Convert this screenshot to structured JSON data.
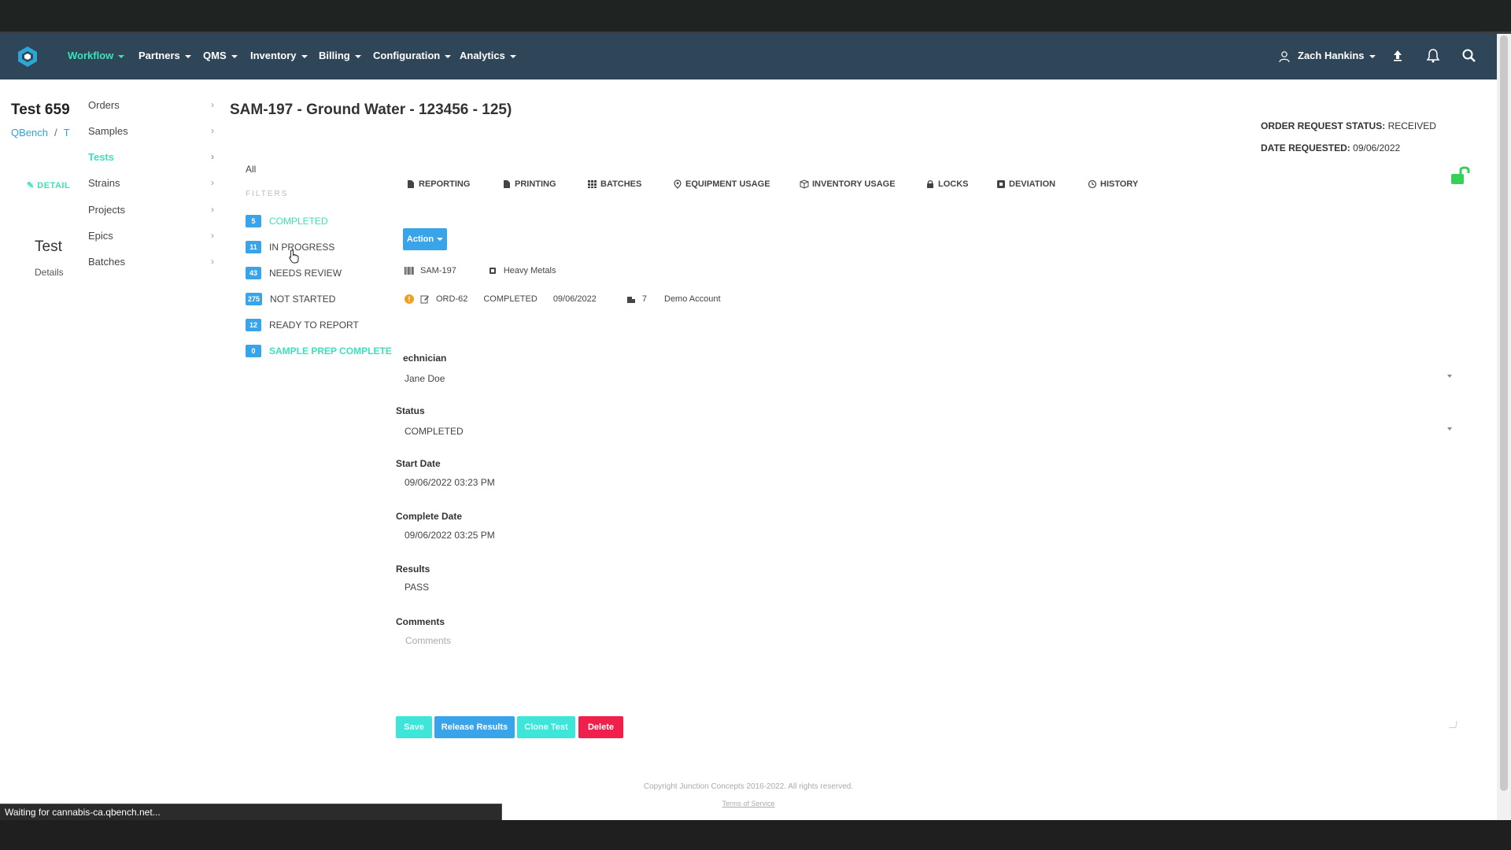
{
  "nav": {
    "items": [
      "Workflow",
      "Partners",
      "QMS",
      "Inventory",
      "Billing",
      "Configuration",
      "Analytics"
    ],
    "user": "Zach Hankins",
    "accent": "#3ee0bd",
    "bar_color": "#2e4658"
  },
  "left": {
    "test_title": "Test 659",
    "crumb_home": "QBench",
    "crumb_sep": "/",
    "crumb_current": "T",
    "detail_link": "DETAIL",
    "test_big": "Test",
    "test_sub": "Details"
  },
  "subnav": [
    "Orders",
    "Samples",
    "Tests",
    "Strains",
    "Projects",
    "Epics",
    "Batches"
  ],
  "header": {
    "sample_title": "SAM-197 - Ground Water - 123456 - 125)",
    "order_status_label": "ORDER REQUEST STATUS:",
    "order_status_value": "RECEIVED",
    "date_requested_label": "DATE REQUESTED:",
    "date_requested_value": "09/06/2022"
  },
  "filters": {
    "all": "All",
    "label": "FILTERS",
    "items": [
      {
        "count": "5",
        "label": "COMPLETED"
      },
      {
        "count": "11",
        "label": "IN PROGRESS"
      },
      {
        "count": "43",
        "label": "NEEDS REVIEW"
      },
      {
        "count": "275",
        "label": "NOT STARTED"
      },
      {
        "count": "12",
        "label": "READY TO REPORT"
      },
      {
        "count": "0",
        "label": "SAMPLE PREP COMPLETE"
      }
    ]
  },
  "tabs": [
    "REPORTING",
    "PRINTING",
    "BATCHES",
    "EQUIPMENT USAGE",
    "INVENTORY USAGE",
    "LOCKS",
    "DEVIATION",
    "HISTORY"
  ],
  "action": {
    "label": "Action"
  },
  "info": {
    "sample_id": "SAM-197",
    "assay": "Heavy Metals",
    "order_id": "ORD-62",
    "order_status": "COMPLETED",
    "order_date": "09/06/2022",
    "account_num": "7",
    "account": "Demo Account"
  },
  "form": {
    "technician_label": "echnician",
    "technician_value": "Jane Doe",
    "status_label": "Status",
    "status_value": "COMPLETED",
    "start_label": "Start Date",
    "start_value": "09/06/2022 03:23 PM",
    "complete_label": "Complete Date",
    "complete_value": "09/06/2022 03:25 PM",
    "results_label": "Results",
    "results_value": "PASS",
    "comments_label": "Comments",
    "comments_placeholder": "Comments"
  },
  "buttons": {
    "save": "Save",
    "release": "Release Results",
    "clone": "Clone Test",
    "delete": "Delete"
  },
  "footer": {
    "copyright": "Copyright Junction Concepts 2016-2022. All rights reserved.",
    "terms": "Terms of Service"
  },
  "status_bar": "Waiting for cannabis-ca.qbench.net..."
}
